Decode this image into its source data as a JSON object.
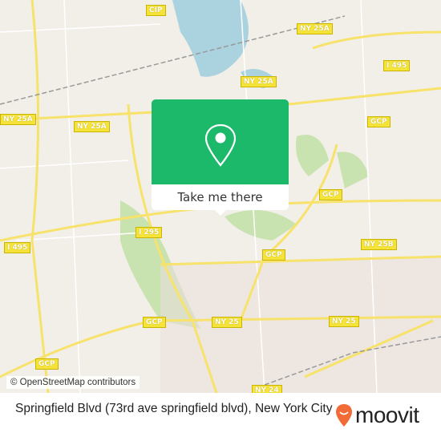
{
  "map": {
    "road_labels": [
      "CIP",
      "NY 25A",
      "NY 25A",
      "NY 25A",
      "NY 25A",
      "I 495",
      "I 495",
      "GCP",
      "GCP",
      "GCP",
      "GCP",
      "GCP",
      "NY 25B",
      "I 295",
      "NY 25",
      "NY 25",
      "NY 24"
    ],
    "attribution": "© OpenStreetMap contributors",
    "colors": {
      "land": "#f2efe9",
      "water": "#aad3df",
      "park": "#c8e2b0",
      "road": "#f7e26b",
      "popup": "#1db96a"
    }
  },
  "popup": {
    "icon": "map-pin-icon",
    "button_label": "Take me there"
  },
  "footer": {
    "address": "Springfield Blvd (73rd ave springfield blvd), New York City",
    "brand": "moovit",
    "brand_color": "#f26a36"
  }
}
